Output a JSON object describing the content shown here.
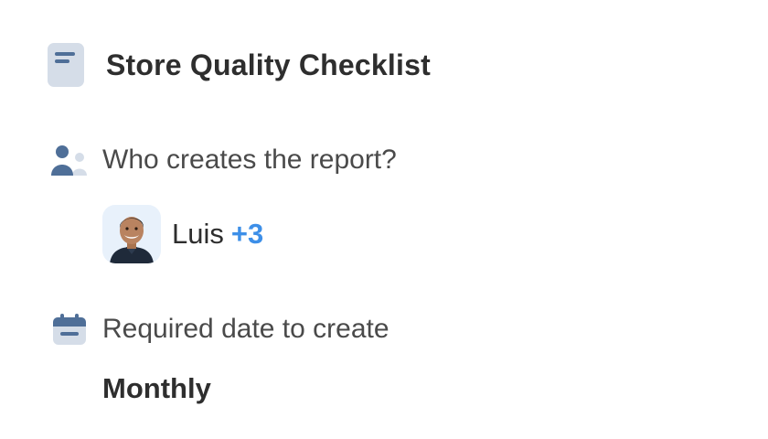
{
  "header": {
    "title": "Store Quality Checklist",
    "icon": "document-icon"
  },
  "creators_section": {
    "label": "Who creates the report?",
    "icon": "users-icon",
    "primary_name": "Luis",
    "more_count": "+3"
  },
  "date_section": {
    "label": "Required date to create",
    "icon": "calendar-icon",
    "value": "Monthly"
  },
  "colors": {
    "icon_light": "#d5dde8",
    "icon_dark": "#4f6f98",
    "accent": "#3d8fe8",
    "text": "#2e2e2e"
  }
}
